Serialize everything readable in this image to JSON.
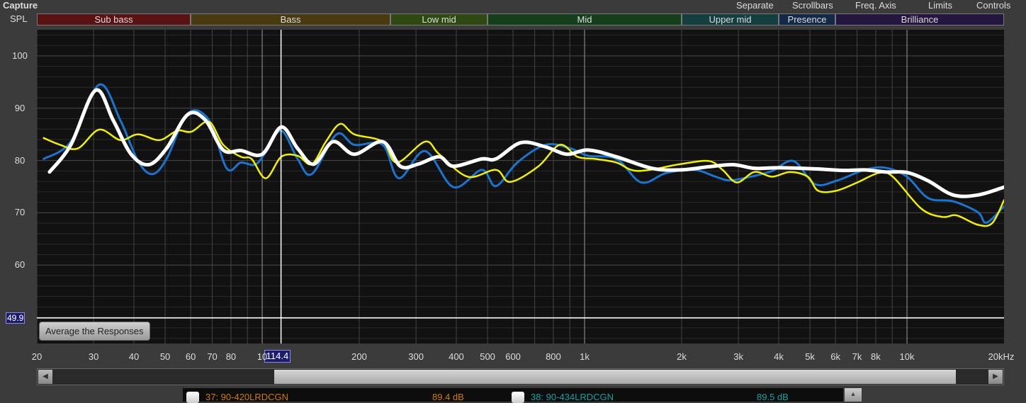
{
  "window": {
    "title": "Capture"
  },
  "menu": [
    "Separate",
    "Scrollbars",
    "Freq. Axis",
    "Limits",
    "Controls"
  ],
  "colors": {
    "blue": "#1a74d0",
    "yellow": "#f0f000",
    "white": "#ffffff",
    "plot_bg": "#111111"
  },
  "chart_data": {
    "type": "line",
    "ylabel": "SPL",
    "xunit": "kHz",
    "xscale": "log",
    "xlim": [
      20,
      20000
    ],
    "ylim": [
      45,
      105
    ],
    "grid": true,
    "yticks": [
      {
        "value": 100,
        "label": "100"
      },
      {
        "value": 90,
        "label": "90"
      },
      {
        "value": 80,
        "label": "80"
      },
      {
        "value": 70,
        "label": "70"
      },
      {
        "value": 60,
        "label": "60"
      }
    ],
    "xticks": [
      {
        "value": 20,
        "label": "20"
      },
      {
        "value": 30,
        "label": "30"
      },
      {
        "value": 40,
        "label": "40"
      },
      {
        "value": 50,
        "label": "50"
      },
      {
        "value": 60,
        "label": "60"
      },
      {
        "value": 70,
        "label": "70"
      },
      {
        "value": 80,
        "label": "80"
      },
      {
        "value": 100,
        "label": "10"
      },
      {
        "value": 200,
        "label": "200"
      },
      {
        "value": 300,
        "label": "300"
      },
      {
        "value": 400,
        "label": "400"
      },
      {
        "value": 500,
        "label": "500"
      },
      {
        "value": 600,
        "label": "600"
      },
      {
        "value": 800,
        "label": "800"
      },
      {
        "value": 1000,
        "label": "1k"
      },
      {
        "value": 2000,
        "label": "2k"
      },
      {
        "value": 3000,
        "label": "3k"
      },
      {
        "value": 4000,
        "label": "4k"
      },
      {
        "value": 5000,
        "label": "5k"
      },
      {
        "value": 6000,
        "label": "6k"
      },
      {
        "value": 7000,
        "label": "7k"
      },
      {
        "value": 8000,
        "label": "8k"
      },
      {
        "value": 10000,
        "label": "10k"
      },
      {
        "value": 20000,
        "label": "20kHz"
      }
    ],
    "bands": [
      {
        "name": "Sub bass",
        "from": 20,
        "to": 60,
        "color": "#5a1212"
      },
      {
        "name": "Bass",
        "from": 60,
        "to": 250,
        "color": "#4a3a12"
      },
      {
        "name": "Low mid",
        "from": 250,
        "to": 500,
        "color": "#2e4a12"
      },
      {
        "name": "Mid",
        "from": 500,
        "to": 2000,
        "color": "#143f1a"
      },
      {
        "name": "Upper mid",
        "from": 2000,
        "to": 4000,
        "color": "#143f40"
      },
      {
        "name": "Presence",
        "from": 4000,
        "to": 6000,
        "color": "#142848"
      },
      {
        "name": "Brilliance",
        "from": 6000,
        "to": 20000,
        "color": "#24163f"
      }
    ],
    "cursor": {
      "freq": 114.4,
      "freq_label": "114.4",
      "spl": 49.9,
      "spl_label": "49.9"
    },
    "series": [
      {
        "name": "blue",
        "color": "#1a74d0",
        "width": 3,
        "x": [
          21,
          25.5,
          31.2,
          36.3,
          41.2,
          45.6,
          50.5,
          58.8,
          68.4,
          77.6,
          85.9,
          95.1,
          102.6,
          114.6,
          128.8,
          142.5,
          170.1,
          193.1,
          236.4,
          265.5,
          320,
          391.9,
          479.8,
          530.9,
          618.1,
          756.8,
          903.6,
          1025.6,
          1256,
          1499,
          1790,
          2193,
          2549,
          2819,
          3281,
          3819,
          4446,
          5175,
          6028,
          7380,
          8589,
          10000,
          11641,
          13904,
          16596,
          17630,
          20000
        ],
        "y": [
          80.3,
          83.6,
          94.5,
          87.7,
          79.9,
          77.4,
          80.3,
          89,
          87.7,
          78.5,
          79.6,
          79.2,
          81.6,
          85.7,
          80.3,
          77.4,
          85,
          83,
          83,
          76.6,
          81.8,
          74.9,
          78.2,
          75.1,
          79.6,
          83,
          82.3,
          80.9,
          80.3,
          75.8,
          77.6,
          78.2,
          76.9,
          76.2,
          76.9,
          78,
          79.9,
          75.5,
          76.1,
          78.2,
          78.6,
          76.9,
          72.8,
          72.2,
          70.1,
          68.1,
          71.2
        ]
      },
      {
        "name": "yellow",
        "color": "#f0f000",
        "width": 2.5,
        "x": [
          21,
          23.6,
          26.8,
          31.2,
          36.3,
          41.2,
          48,
          54.5,
          60.3,
          68.4,
          75.7,
          85.9,
          92.7,
          102.6,
          114.6,
          128.8,
          142.5,
          157.6,
          174.5,
          193.1,
          236.4,
          261.6,
          320,
          354.1,
          433.6,
          530.9,
          587.5,
          719.4,
          837.4,
          950.5,
          1078.9,
          1256,
          1462,
          1981,
          2427,
          2680,
          2965,
          3365,
          3819,
          4335,
          4920,
          5306,
          6028,
          7016,
          8166,
          9035,
          11067,
          12882,
          14256,
          16596,
          18366,
          20000
        ],
        "y": [
          84.3,
          83,
          82.3,
          85.9,
          83.9,
          85,
          83.9,
          85.7,
          85.5,
          87.4,
          83,
          80.7,
          80.3,
          76.6,
          80.7,
          80.9,
          79.3,
          83.6,
          87,
          85,
          83.6,
          79.6,
          83.6,
          81.2,
          76.9,
          78.2,
          75.9,
          78.9,
          83,
          80.7,
          80.3,
          79.6,
          78,
          79.3,
          79.9,
          78.2,
          75.8,
          77.8,
          76.9,
          77.8,
          76.9,
          74.2,
          74.2,
          75.8,
          77.6,
          76.9,
          70.8,
          69.2,
          69.5,
          67.7,
          68,
          72.4
        ]
      },
      {
        "name": "average",
        "color": "#ffffff",
        "width": 5,
        "x": [
          21.9,
          25.5,
          30.4,
          34.5,
          39.2,
          44.5,
          50.5,
          58.8,
          66.7,
          75.7,
          85.9,
          100,
          114.6,
          128.8,
          144.6,
          165.9,
          193.1,
          236.4,
          268.3,
          304.3,
          354.1,
          391.9,
          479.8,
          530.9,
          633.9,
          756.8,
          880.8,
          1025.6,
          1256,
          1618,
          1981,
          2427,
          2891,
          3365,
          4018,
          5175,
          6340,
          7380,
          8589,
          10000,
          11641,
          13904,
          16596,
          20000
        ],
        "y": [
          77.8,
          83,
          93.4,
          87.7,
          81.2,
          79.2,
          82.3,
          88.8,
          87.7,
          82,
          81.9,
          81.2,
          86.4,
          82.3,
          79.3,
          83.6,
          81.2,
          83.6,
          78.9,
          79.3,
          80.7,
          78.9,
          80.3,
          80.3,
          83.4,
          82.6,
          81.2,
          82,
          80.7,
          78.5,
          78.2,
          78.8,
          79.2,
          78.5,
          78.6,
          78.4,
          78.1,
          78.2,
          77.8,
          77.7,
          76.1,
          73.4,
          73.4,
          74.9
        ]
      }
    ]
  },
  "buttons": {
    "average": "Average the Responses"
  },
  "legend": [
    {
      "name": "37: 90-420LRDCGN",
      "value": "89.4 dB",
      "color": "#d07a10"
    },
    {
      "name": "38: 90-434LRDCGN",
      "value": "89.5 dB",
      "color": "#16a0a0"
    }
  ]
}
